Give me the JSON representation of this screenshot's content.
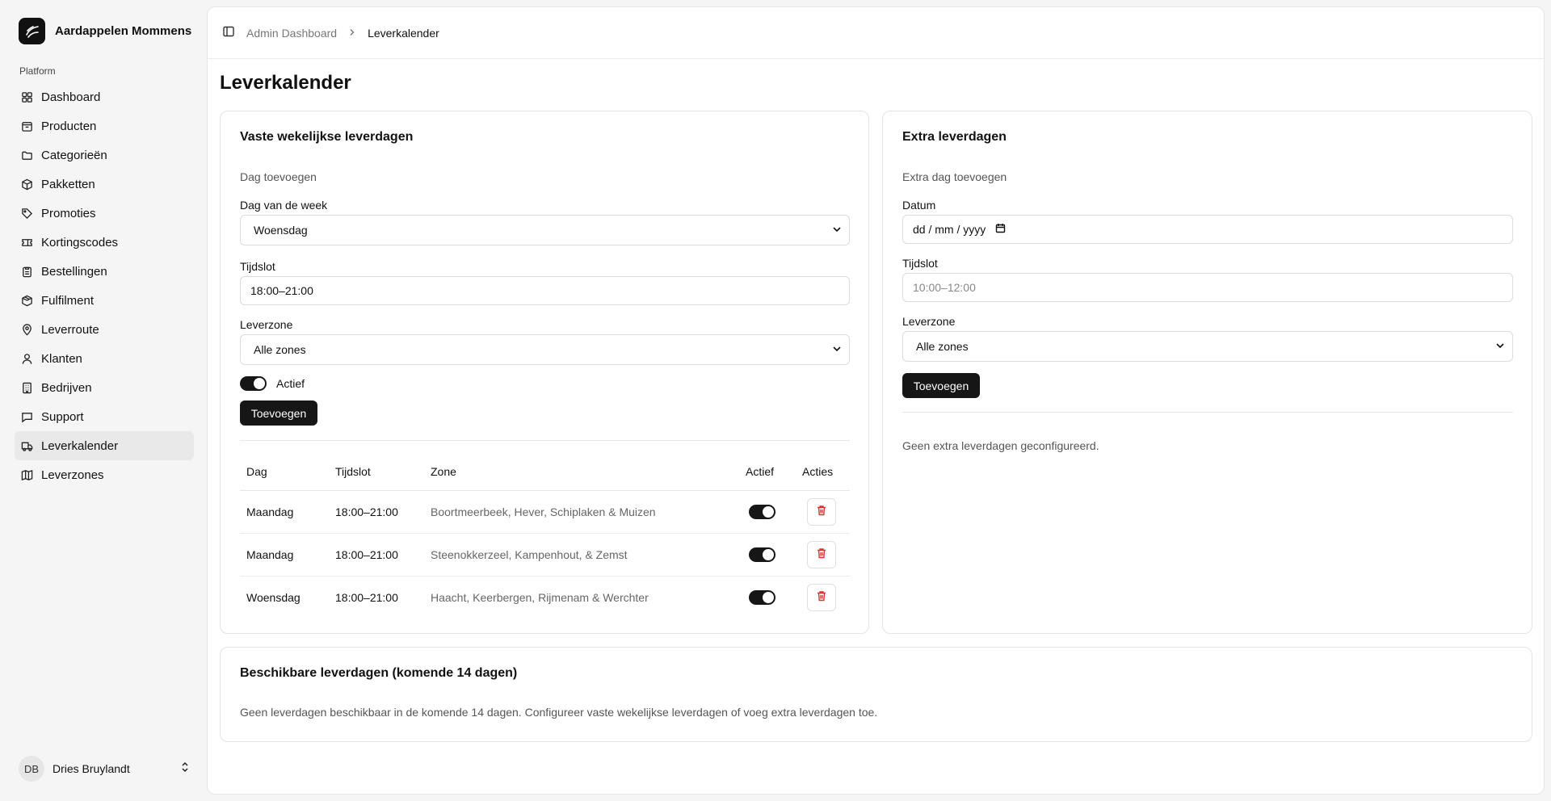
{
  "app": {
    "name": "Aardappelen Mommens"
  },
  "sidebar": {
    "section": "Platform",
    "items": [
      {
        "label": "Dashboard",
        "icon": "grid-icon"
      },
      {
        "label": "Producten",
        "icon": "box-icon"
      },
      {
        "label": "Categorieën",
        "icon": "folder-icon"
      },
      {
        "label": "Pakketten",
        "icon": "package-icon"
      },
      {
        "label": "Promoties",
        "icon": "tag-icon"
      },
      {
        "label": "Kortingscodes",
        "icon": "ticket-icon"
      },
      {
        "label": "Bestellingen",
        "icon": "clipboard-icon"
      },
      {
        "label": "Fulfilment",
        "icon": "package-check-icon"
      },
      {
        "label": "Leverroute",
        "icon": "map-pin-icon"
      },
      {
        "label": "Klanten",
        "icon": "users-icon"
      },
      {
        "label": "Bedrijven",
        "icon": "building-icon"
      },
      {
        "label": "Support",
        "icon": "message-icon"
      },
      {
        "label": "Leverkalender",
        "icon": "truck-icon",
        "active": true
      },
      {
        "label": "Leverzones",
        "icon": "map-icon"
      }
    ],
    "user": {
      "initials": "DB",
      "name": "Dries Bruylandt"
    }
  },
  "breadcrumb": {
    "parent": "Admin Dashboard",
    "current": "Leverkalender"
  },
  "page": {
    "title": "Leverkalender"
  },
  "weekly": {
    "title": "Vaste wekelijkse leverdagen",
    "subtitle": "Dag toevoegen",
    "day_label": "Dag van de week",
    "day_value": "Woensdag",
    "slot_label": "Tijdslot",
    "slot_value": "18:00–21:00",
    "zone_label": "Leverzone",
    "zone_value": "Alle zones",
    "active_label": "Actief",
    "add_button": "Toevoegen",
    "table": {
      "headers": [
        "Dag",
        "Tijdslot",
        "Zone",
        "Actief",
        "Acties"
      ],
      "rows": [
        {
          "day": "Maandag",
          "slot": "18:00–21:00",
          "zone": "Boortmeerbeek, Hever, Schiplaken & Muizen",
          "active": true
        },
        {
          "day": "Maandag",
          "slot": "18:00–21:00",
          "zone": "Steenokkerzeel, Kampenhout, & Zemst",
          "active": true
        },
        {
          "day": "Woensdag",
          "slot": "18:00–21:00",
          "zone": "Haacht, Keerbergen, Rijmenam & Werchter",
          "active": true
        }
      ]
    }
  },
  "extra": {
    "title": "Extra leverdagen",
    "subtitle": "Extra dag toevoegen",
    "date_label": "Datum",
    "date_placeholder": "dd / mm / yyyy",
    "slot_label": "Tijdslot",
    "slot_placeholder": "10:00–12:00",
    "zone_label": "Leverzone",
    "zone_value": "Alle zones",
    "add_button": "Toevoegen",
    "empty": "Geen extra leverdagen geconfigureerd."
  },
  "available": {
    "title": "Beschikbare leverdagen (komende 14 dagen)",
    "empty": "Geen leverdagen beschikbaar in de komende 14 dagen. Configureer vaste wekelijkse leverdagen of voeg extra leverdagen toe."
  }
}
